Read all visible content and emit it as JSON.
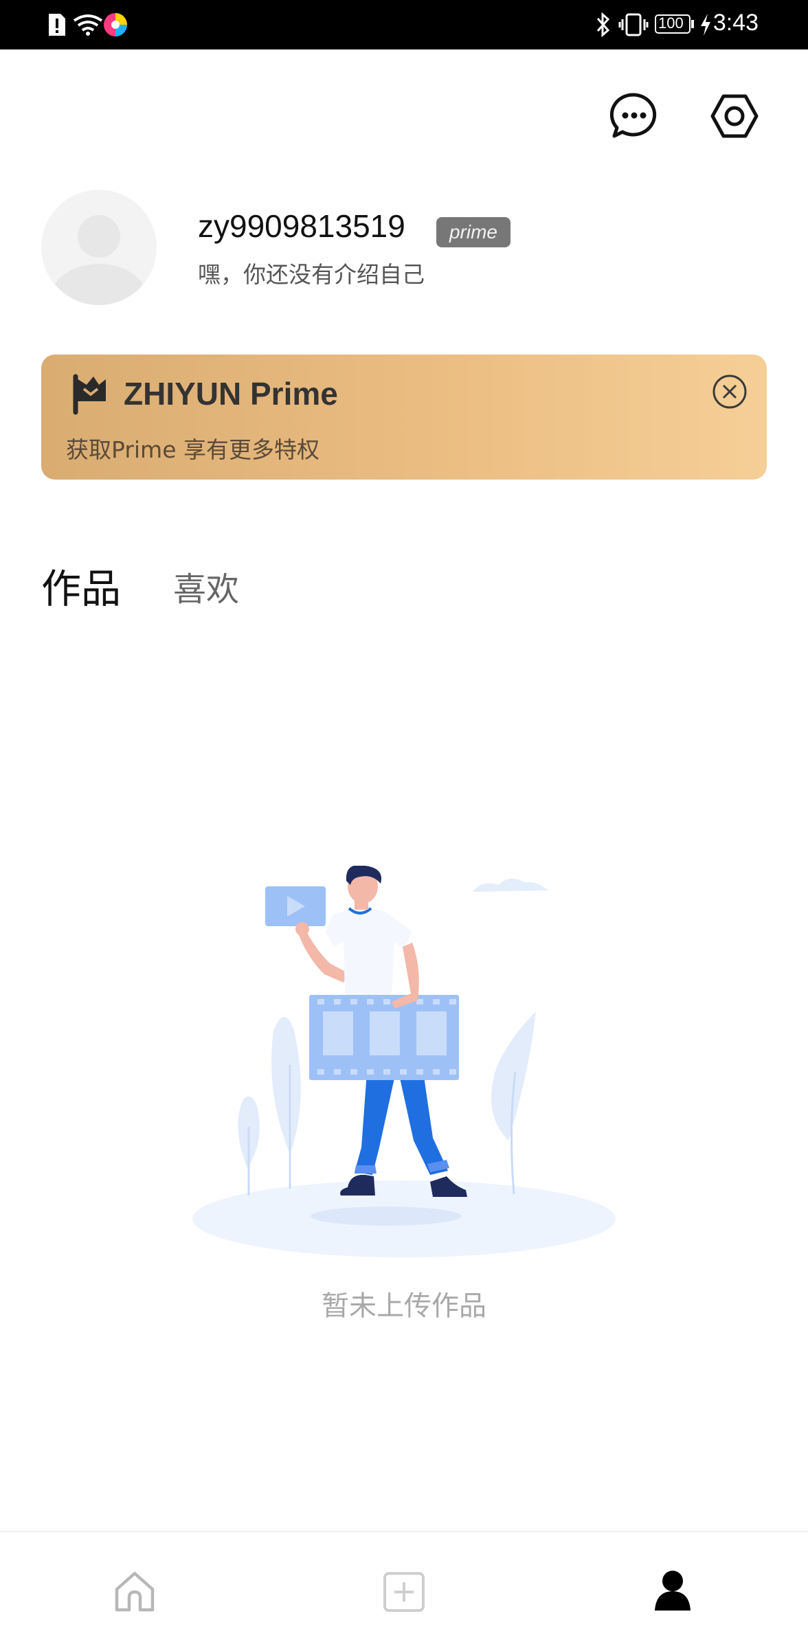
{
  "status_bar": {
    "time": "3:43",
    "battery": "100",
    "icons": [
      "sim-alert-icon",
      "wifi-icon",
      "app-color-icon",
      "bluetooth-icon",
      "vibrate-icon",
      "battery-icon",
      "charging-icon"
    ]
  },
  "header": {
    "icons": [
      "message-icon",
      "settings-icon"
    ]
  },
  "profile": {
    "username": "zy9909813519",
    "badge": "prime",
    "bio": "嘿，你还没有介绍自己"
  },
  "prime_banner": {
    "title": "ZHIYUN Prime",
    "subtitle": "获取Prime 享有更多特权",
    "colors": {
      "start": "#d9ac72",
      "end": "#f5cf97"
    }
  },
  "tabs": [
    {
      "label": "作品",
      "active": true
    },
    {
      "label": "喜欢",
      "active": false
    }
  ],
  "empty_state": {
    "message": "暂未上传作品"
  },
  "bottom_nav": {
    "items": [
      {
        "icon": "home-icon",
        "active": false
      },
      {
        "icon": "add-icon",
        "active": false
      },
      {
        "icon": "profile-icon",
        "active": true
      }
    ]
  },
  "colors": {
    "accent_blue": "#1f6fe0",
    "light_blue": "#9dc0f7"
  }
}
